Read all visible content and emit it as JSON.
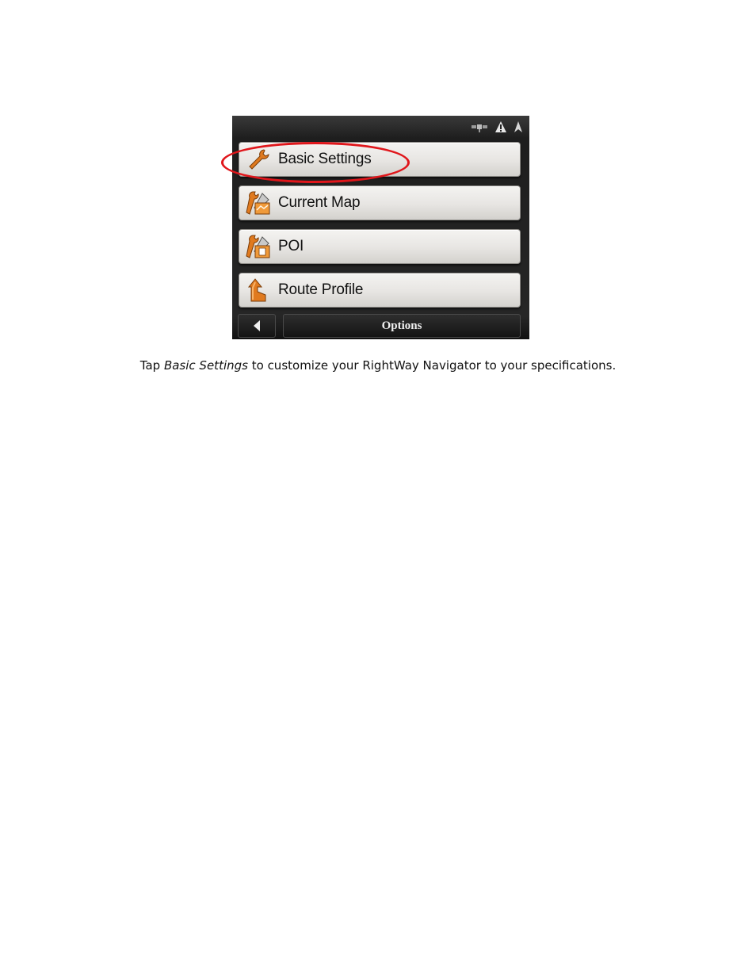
{
  "screen": {
    "status_icons": [
      "satellite-icon",
      "warning-icon",
      "gps-signal-icon"
    ],
    "menu": {
      "items": [
        {
          "label": "Basic Settings",
          "icon": "wrench-icon"
        },
        {
          "label": "Current Map",
          "icon": "map-tools-icon"
        },
        {
          "label": "POI",
          "icon": "poi-tools-icon"
        },
        {
          "label": "Route Profile",
          "icon": "route-profile-icon"
        }
      ]
    },
    "bottom_bar": {
      "back_icon": "back-arrow-icon",
      "title": "Options"
    },
    "highlighted_item": "Basic Settings",
    "colors": {
      "highlight_ring": "#e0161b",
      "icon_orange": "#e07a1f",
      "background": "#222222"
    }
  },
  "caption": {
    "before": "Tap ",
    "emphasis": "Basic Settings",
    "after": " to customize your RightWay Navigator to your specifications."
  }
}
